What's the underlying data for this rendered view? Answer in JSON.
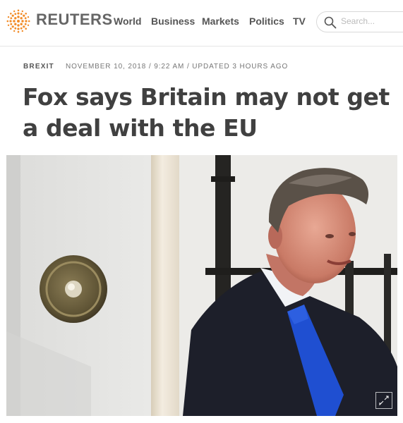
{
  "header": {
    "brand": "REUTERS",
    "nav": [
      "World",
      "Business",
      "Markets",
      "Politics",
      "TV"
    ],
    "search_placeholder": "Search..."
  },
  "article": {
    "section": "BREXIT",
    "dateline": "NOVEMBER 10, 2018 / 9:22 AM / UPDATED 3 HOURS AGO",
    "headline": "Fox says Britain may not get a deal with the EU"
  },
  "icons": {
    "logo": "reuters-dot-logo-icon",
    "search": "search-icon",
    "expand": "expand-icon"
  },
  "colors": {
    "logo_orange": "#f28c28",
    "text_dark": "#404040",
    "tie_blue": "#1f4fd1"
  }
}
